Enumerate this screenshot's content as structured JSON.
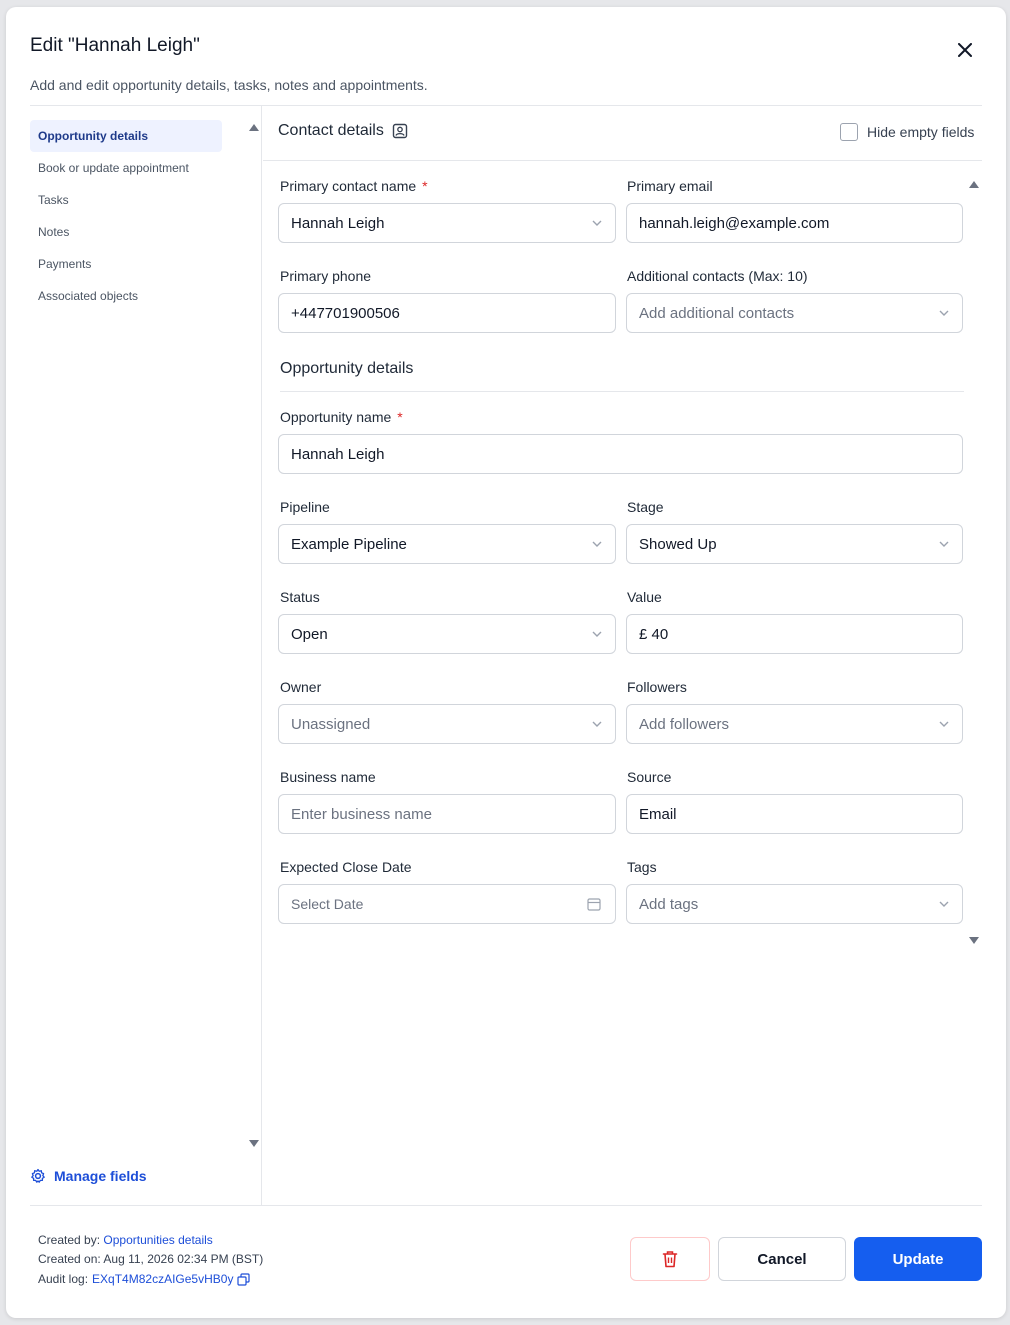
{
  "modal": {
    "title": "Edit \"Hannah Leigh\"",
    "subtitle": "Add and edit opportunity details, tasks, notes and appointments."
  },
  "nav": {
    "items": [
      {
        "label": "Opportunity details",
        "active": true
      },
      {
        "label": "Book or update appointment"
      },
      {
        "label": "Tasks"
      },
      {
        "label": "Notes"
      },
      {
        "label": "Payments"
      },
      {
        "label": "Associated objects"
      }
    ],
    "manage_fields": "Manage fields"
  },
  "contact": {
    "section_title": "Contact details",
    "hide_empty_label": "Hide empty fields",
    "primary_contact_name": {
      "label": "Primary contact name",
      "value": "Hannah Leigh"
    },
    "primary_email": {
      "label": "Primary email",
      "value": "hannah.leigh@example.com"
    },
    "primary_phone": {
      "label": "Primary phone",
      "value": "+447701900506"
    },
    "additional_contacts": {
      "label": "Additional contacts (Max: 10)",
      "placeholder": "Add additional contacts"
    }
  },
  "opportunity": {
    "section_title": "Opportunity details",
    "name": {
      "label": "Opportunity name",
      "value": "Hannah Leigh"
    },
    "pipeline": {
      "label": "Pipeline",
      "value": "Example Pipeline"
    },
    "stage": {
      "label": "Stage",
      "value": "Showed Up"
    },
    "status": {
      "label": "Status",
      "value": "Open"
    },
    "value": {
      "label": "Value",
      "value": "£ 40"
    },
    "owner": {
      "label": "Owner",
      "value": "Unassigned"
    },
    "followers": {
      "label": "Followers",
      "placeholder": "Add followers"
    },
    "business_name": {
      "label": "Business name",
      "placeholder": "Enter business name"
    },
    "source": {
      "label": "Source",
      "value": "Email"
    },
    "expected_close_date": {
      "label": "Expected Close Date",
      "placeholder": "Select Date"
    },
    "tags": {
      "label": "Tags",
      "placeholder": "Add tags"
    }
  },
  "footer": {
    "created_by_label": "Created by:",
    "created_by_value": "Opportunities details",
    "created_on_label": "Created on:",
    "created_on_value": "Aug 11, 2026 02:34 PM (BST)",
    "audit_log_label": "Audit log:",
    "audit_log_value": "EXqT4M82czAIGe5vHB0y",
    "cancel_label": "Cancel",
    "update_label": "Update"
  },
  "colors": {
    "primary": "#155eef",
    "link": "#1d4ed8",
    "danger": "#dc2626",
    "nav_active_bg": "#eef2ff"
  }
}
